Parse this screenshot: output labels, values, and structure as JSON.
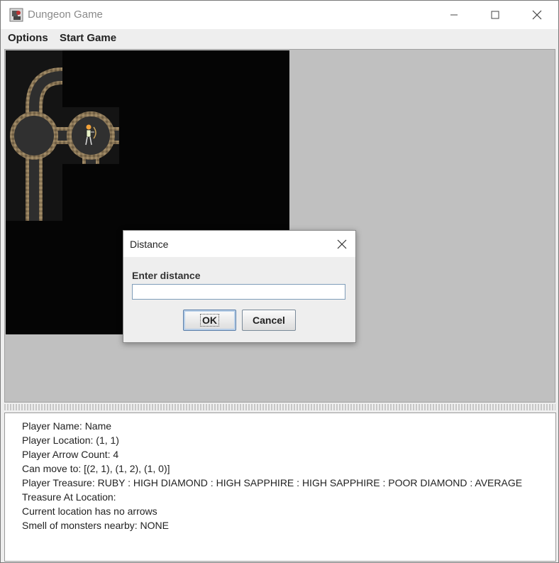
{
  "window": {
    "title": "Dungeon Game",
    "icon": "dungeon-app-icon"
  },
  "menu": {
    "items": [
      "Options",
      "Start Game"
    ]
  },
  "dialog": {
    "title": "Distance",
    "label": "Enter distance",
    "input_value": "",
    "ok_label": "OK",
    "cancel_label": "Cancel"
  },
  "info": {
    "lines": [
      "Player Name: Name",
      "Player Location: (1, 1)",
      "Player Arrow Count: 4",
      "Can move to: [(2, 1), (1, 2), (1, 0)]",
      "Player Treasure: RUBY : HIGH DIAMOND : HIGH SAPPHIRE : HIGH SAPPHIRE : POOR DIAMOND : AVERAGE",
      "Treasure At Location:",
      "Current location has no arrows",
      "Smell of monsters nearby: NONE"
    ]
  },
  "colors": {
    "game_background": "#c0c0c0",
    "board_background": "#050505",
    "tunnel_stone": "#8a7656",
    "tunnel_floor": "#2e2e2e"
  }
}
